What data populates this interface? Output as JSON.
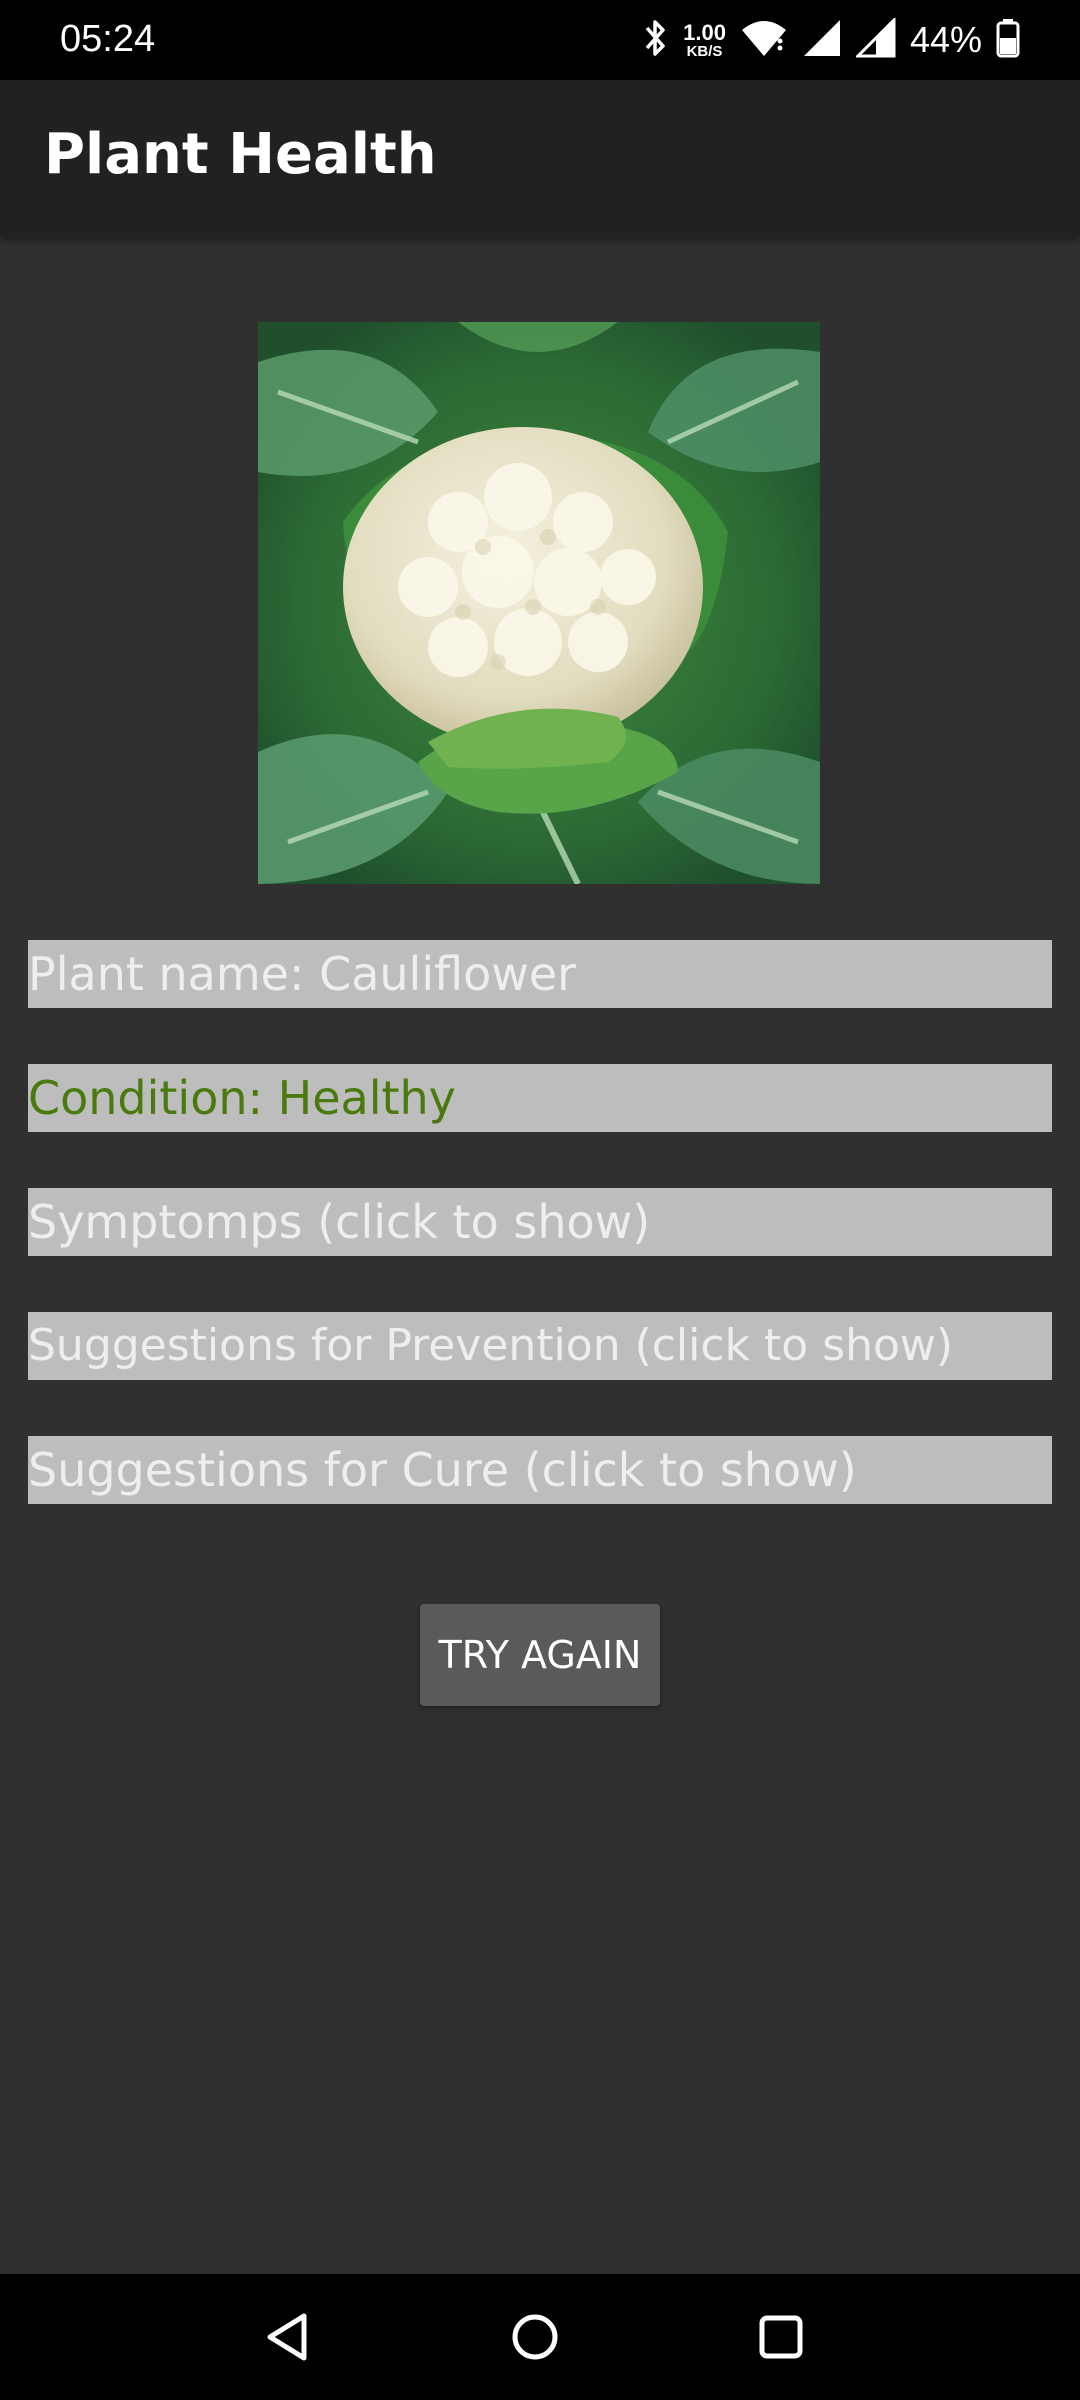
{
  "status_bar": {
    "time": "05:24",
    "net_speed_value": "1.00",
    "net_speed_unit": "KB/S",
    "battery_percent": "44%",
    "icons": [
      "bluetooth-icon",
      "wifi-icon",
      "signal-icon",
      "signal-icon",
      "battery-icon"
    ]
  },
  "app_bar": {
    "title": "Plant Health"
  },
  "result": {
    "plant_name": "Plant name: Cauliflower",
    "condition": "Condition: Healthy",
    "symptoms": "Symptomps (click to show)",
    "prevention": "Suggestions for Prevention (click to show)",
    "cure": "Suggestions for Cure (click to show)"
  },
  "actions": {
    "try_again_label": "TRY AGAIN"
  },
  "colors": {
    "background": "#303030",
    "app_bar": "#212121",
    "row_background": "#bdbdbd",
    "row_text": "#eeeeee",
    "healthy_text": "#4a7a0e",
    "button": "#5a5a5a"
  }
}
